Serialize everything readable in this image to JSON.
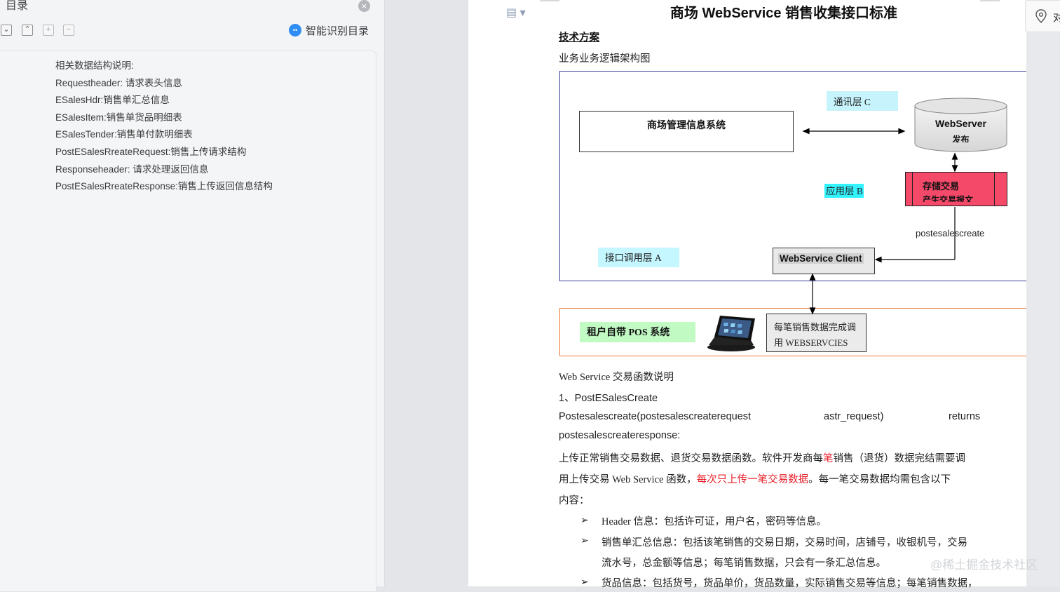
{
  "sidebar": {
    "title": "目录",
    "smart_label": "智能识别目录",
    "toolbar_buttons": [
      {
        "name": "expand-all",
        "glyph": "⌄"
      },
      {
        "name": "collapse-all",
        "glyph": "⌃"
      },
      {
        "name": "add-level",
        "glyph": "+"
      },
      {
        "name": "remove-level",
        "glyph": "−"
      }
    ],
    "items": [
      "相关数据结构说明:",
      "Requestheader:  请求表头信息",
      "ESalesHdr:销售单汇总信息",
      "ESalesItem:销售单货品明细表",
      "ESalesTender:销售单付款明细表",
      "PostESalesRreateRequest:销售上传请求结构",
      "Responseheader:  请求处理返回信息",
      "PostESalesRreateResponse:销售上传返回信息结构"
    ]
  },
  "document": {
    "title": "商场 WebService 销售收集接口标准",
    "tech_heading": "技术方案",
    "arch_heading": "业务业务逻辑架构图",
    "diagram": {
      "mall_system": "商场管理信息系统",
      "comm_layer": "通讯层  C",
      "webserver": "WebServer",
      "webserver_sub": "发布",
      "app_layer": "应用层 B",
      "store_label": "存储交易",
      "store_sub": "产生交易报文",
      "post_label": "postesalescreate",
      "api_layer": "接口调用层  A",
      "client_label": "WebService Client",
      "pos_label": "租户自带 POS 系统",
      "complete_line1": "每笔销售数据完成调",
      "complete_line2": "用 WEBSERVCIES"
    },
    "fn_heading": "Web Service 交易函数说明",
    "fn_name": "1、PostESalesCreate",
    "signature": {
      "part1": "Postesalescreate(postesalescreaterequest",
      "part2": "astr_request)",
      "part3": "returns",
      "part4": "postesalescreateresponse:"
    },
    "desc": {
      "l1a": "上传正常销售交易数据、退货交易数据函数。软件开发商每",
      "l1b": "笔",
      "l1c": "销售（退货）数据完结需要调",
      "l2a": "用上传交易 Web Service 函数，",
      "l2b": "每次只上传一笔交易数据",
      "l2c": "。每一笔交易数据均需包含以下",
      "l3": "内容："
    },
    "bullets": {
      "mark": "➢",
      "b1": "Header 信息：包括许可证，用户名，密码等信息。",
      "b2a": "销售单汇总信息：包括该笔销售的交易日期，交易时间，店铺号，收银机号，交易",
      "b2b": "流水号，总金额等信息；每笔销售数据，只会有一条汇总信息。",
      "b3": "货品信息：包括货号，货品单价，货品数量，实际销售交易等信息；每笔销售数据，"
    }
  },
  "right_panel": {
    "label": "对"
  },
  "watermark": "@稀土掘金技术社区",
  "colors": {
    "accent_blue": "#2f8df4",
    "diagram_border": "#3c3c9a",
    "pos_border": "#ef7a3a",
    "store_red": "#f5496a",
    "highlight_red": "#e8202a"
  }
}
